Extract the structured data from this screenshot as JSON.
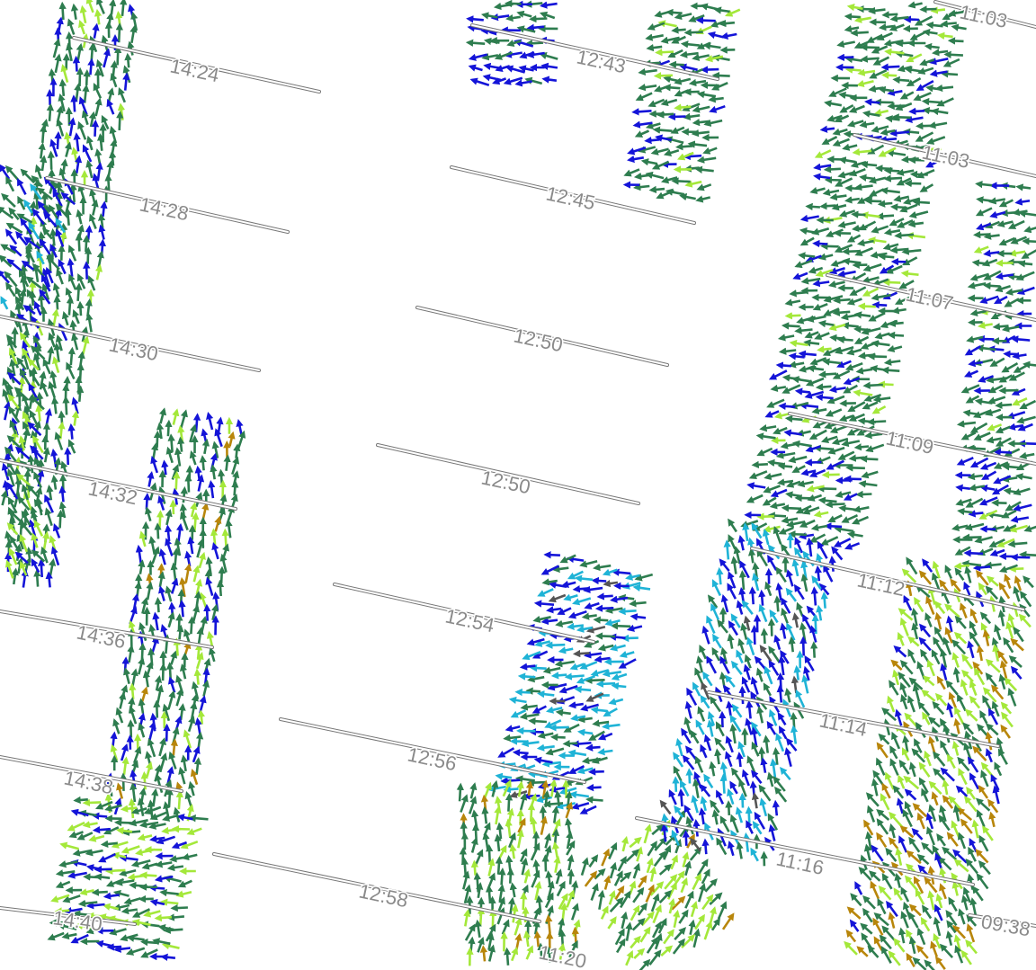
{
  "map": {
    "track_labels": [
      "14:24",
      "14:28",
      "14:30",
      "14:32",
      "14:36",
      "14:38",
      "14:40",
      "12:43",
      "12:45",
      "12:50",
      "12:50",
      "12:54",
      "12:56",
      "12:58",
      "11:20",
      "11:03",
      "11:03",
      "11:07",
      "11:09",
      "11:12",
      "11:14",
      "11:16",
      "09:38"
    ],
    "palette": {
      "dark_green": "#2e7d4f",
      "mid_green": "#3a8f5a",
      "lime": "#a4e83a",
      "yellow_green": "#c8f05a",
      "blue": "#1414d8",
      "cyan": "#1fb3d6",
      "orange": "#b8860b",
      "gray": "#555555"
    }
  }
}
